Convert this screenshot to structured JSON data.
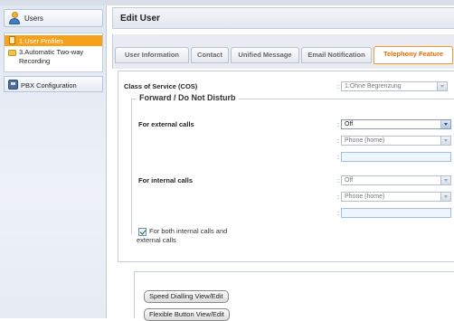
{
  "sidebar": {
    "header": "Users",
    "items": [
      "1.User Profiles",
      "3.Automatic Two-way Recording"
    ],
    "pbx": "PBX Configuration"
  },
  "main": {
    "title": "Edit User",
    "tabs": [
      "User Information",
      "Contact",
      "Unified Message",
      "Email Notification",
      "Telephony Feature"
    ]
  },
  "form": {
    "cos_label": "Class of Service (COS)",
    "cos_value": "1:Ohne Begrenzung",
    "section": "Forward / Do Not Disturb",
    "external_label": "For external calls",
    "external_mode": "Off",
    "external_dest": "Phone (home)",
    "internal_label": "For internal calls",
    "internal_mode": "Off",
    "internal_dest": "Phone (home)",
    "both_checkbox": "For both internal calls and external calls",
    "both_checked": true
  },
  "buttons": {
    "speed": "Speed Dialling View/Edit",
    "flexible": "Flexible Button View/Edit"
  },
  "colors": {
    "accent": "#f5a11c",
    "tab_active_text": "#e46c00"
  }
}
